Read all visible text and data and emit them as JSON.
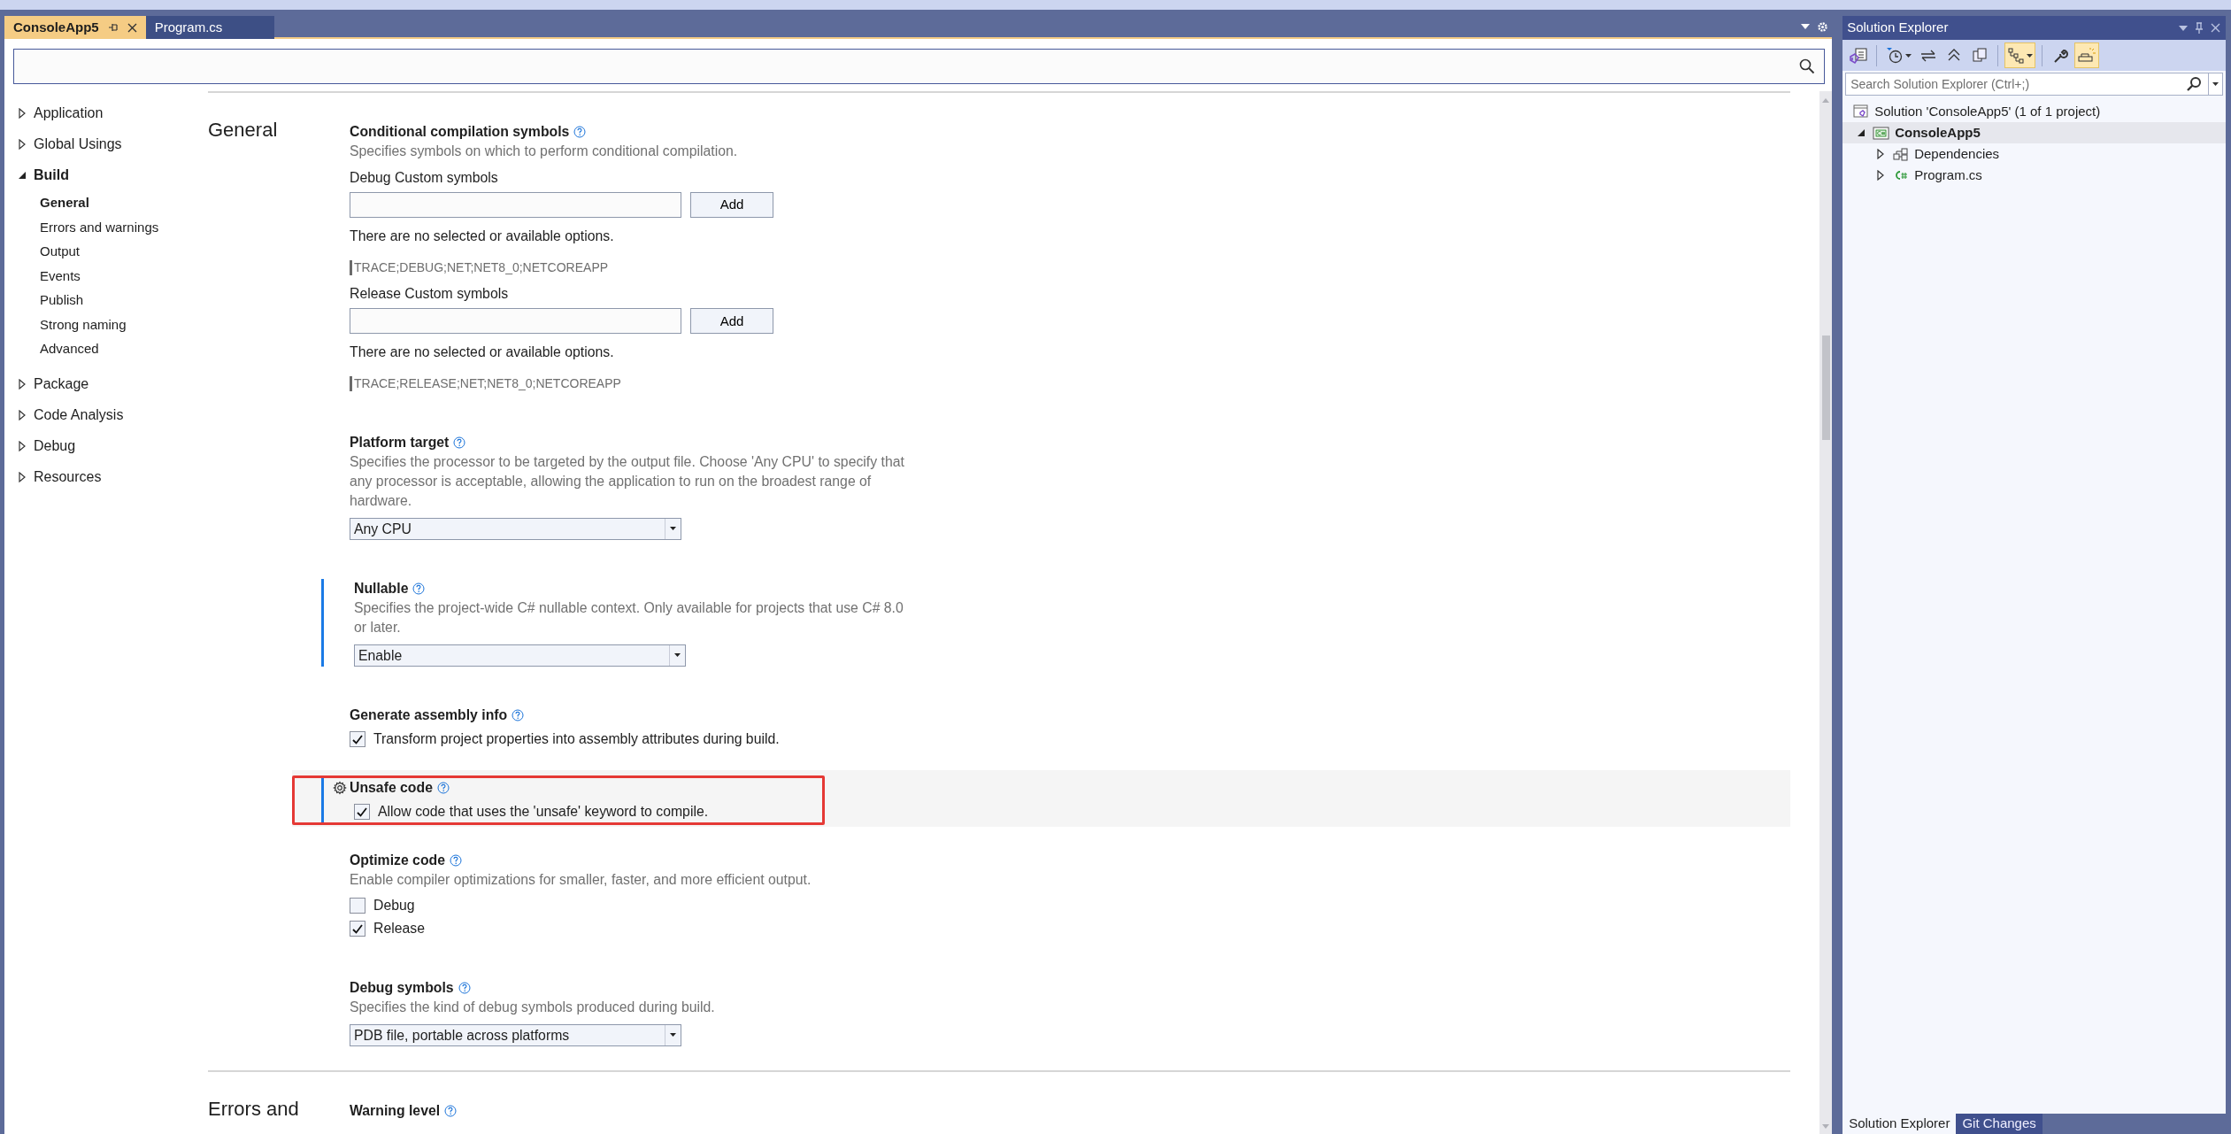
{
  "doc_tabs": [
    {
      "label": "ConsoleApp5",
      "selected": true
    },
    {
      "label": "Program.cs",
      "selected": false
    }
  ],
  "nav": [
    {
      "label": "Application",
      "expanded": false
    },
    {
      "label": "Global Usings",
      "expanded": false
    },
    {
      "label": "Build",
      "expanded": true,
      "children": [
        {
          "label": "General",
          "selected": true
        },
        {
          "label": "Errors and warnings",
          "selected": false
        },
        {
          "label": "Output",
          "selected": false
        },
        {
          "label": "Events",
          "selected": false
        },
        {
          "label": "Publish",
          "selected": false
        },
        {
          "label": "Strong naming",
          "selected": false
        },
        {
          "label": "Advanced",
          "selected": false
        }
      ]
    },
    {
      "label": "Package",
      "expanded": false
    },
    {
      "label": "Code Analysis",
      "expanded": false
    },
    {
      "label": "Debug",
      "expanded": false
    },
    {
      "label": "Resources",
      "expanded": false
    }
  ],
  "sections": [
    {
      "title": "General",
      "settings": [
        {
          "kind": "symbols",
          "title": "Conditional compilation symbols",
          "description": "Specifies symbols on which to perform conditional compilation.",
          "changed": false,
          "hovered": false,
          "highlighted": false,
          "groups": [
            {
              "label": "Debug Custom symbols",
              "button": "Add",
              "note": "There are no selected or available options.",
              "symbols": "TRACE;DEBUG;NET;NET8_0;NETCOREAPP"
            },
            {
              "label": "Release Custom symbols",
              "button": "Add",
              "note": "There are no selected or available options.",
              "symbols": "TRACE;RELEASE;NET;NET8_0;NETCOREAPP"
            }
          ]
        },
        {
          "kind": "dropdown",
          "title": "Platform target",
          "description": "Specifies the processor to be targeted by the output file. Choose 'Any CPU' to specify that any processor is acceptable, allowing the application to run on the broadest range of hardware.",
          "changed": false,
          "hovered": false,
          "highlighted": false,
          "value": "Any CPU"
        },
        {
          "kind": "dropdown",
          "title": "Nullable",
          "description": "Specifies the project-wide C# nullable context. Only available for projects that use C# 8.0 or later.",
          "changed": true,
          "hovered": false,
          "highlighted": false,
          "value": "Enable"
        },
        {
          "kind": "checkbox",
          "title": "Generate assembly info",
          "changed": false,
          "hovered": false,
          "highlighted": false,
          "options": [
            {
              "label": "Transform project properties into assembly attributes during build.",
              "checked": true
            }
          ]
        },
        {
          "kind": "checkbox",
          "title": "Unsafe code",
          "changed": true,
          "hovered": true,
          "highlighted": true,
          "options": [
            {
              "label": "Allow code that uses the 'unsafe' keyword to compile.",
              "checked": true
            }
          ]
        },
        {
          "kind": "checkbox",
          "title": "Optimize code",
          "description": "Enable compiler optimizations for smaller, faster, and more efficient output.",
          "changed": false,
          "hovered": false,
          "highlighted": false,
          "options": [
            {
              "label": "Debug",
              "checked": false
            },
            {
              "label": "Release",
              "checked": true
            }
          ]
        },
        {
          "kind": "dropdown",
          "title": "Debug symbols",
          "description": "Specifies the kind of debug symbols produced during build.",
          "changed": false,
          "hovered": false,
          "highlighted": false,
          "value": "PDB file, portable across platforms"
        }
      ]
    },
    {
      "title": "Errors and",
      "settings": [
        {
          "kind": "dropdown",
          "title": "Warning level",
          "changed": false,
          "hovered": false,
          "highlighted": false
        }
      ]
    }
  ],
  "solution_explorer": {
    "title": "Solution Explorer",
    "toolbar": [
      [
        {
          "kind": "switch-views",
          "on": false
        }
      ],
      [
        {
          "kind": "pending-changes",
          "on": false
        },
        {
          "kind": "sync",
          "on": false
        },
        {
          "kind": "collapse-all",
          "on": false
        },
        {
          "kind": "show-all",
          "on": false
        }
      ],
      [
        {
          "kind": "view-toggle",
          "on": true
        }
      ],
      [
        {
          "kind": "properties",
          "on": false
        },
        {
          "kind": "preview",
          "on": true
        }
      ]
    ],
    "search": {
      "placeholder": "Search Solution Explorer (Ctrl+;)"
    },
    "tree": [
      {
        "kind": "solution",
        "label": "Solution 'ConsoleApp5' (1 of 1 project)",
        "selected": false,
        "children": [
          {
            "kind": "project",
            "label": "ConsoleApp5",
            "expanded": true,
            "selected": true,
            "children": [
              {
                "kind": "dependencies",
                "label": "Dependencies",
                "expanded": false,
                "selected": false
              },
              {
                "kind": "csfile",
                "label": "Program.cs",
                "expanded": false,
                "selected": false
              }
            ]
          }
        ]
      }
    ],
    "tabs": [
      {
        "label": "Solution Explorer",
        "selected": true
      },
      {
        "label": "Git Changes",
        "selected": false
      }
    ]
  }
}
